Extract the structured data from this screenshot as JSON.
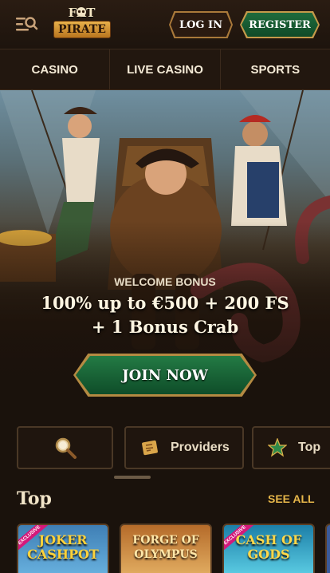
{
  "header": {
    "menu_icon": "menu-search-icon",
    "logo_top": "FAT",
    "logo_bottom": "PIRATE",
    "login_label": "LOG IN",
    "register_label": "REGISTER"
  },
  "nav": {
    "items": [
      {
        "label": "CASINO"
      },
      {
        "label": "LIVE CASINO"
      },
      {
        "label": "SPORTS"
      }
    ]
  },
  "hero": {
    "subtitle": "WELCOME BONUS",
    "title_line1": "100% up to €500 + 200 FS",
    "title_line2": "+ 1 Bonus Crab",
    "cta_label": "JOIN NOW"
  },
  "categories": {
    "search_icon": "search-icon",
    "providers_label": "Providers",
    "providers_icon": "scroll-map-icon",
    "top_label": "Top",
    "top_icon": "star-icon"
  },
  "top_section": {
    "title": "Top",
    "see_all": "SEE ALL",
    "games": [
      {
        "name": "JOKER CASHPOT",
        "badge": "EXCLUSIVE"
      },
      {
        "name": "FORGE OF OLYMPUS"
      },
      {
        "name": "CASH OF GODS",
        "badge": "EXCLUSIVE"
      }
    ]
  },
  "colors": {
    "background": "#1a120c",
    "accent_gold": "#e6b64a",
    "register_green": "#1f6b3c"
  }
}
